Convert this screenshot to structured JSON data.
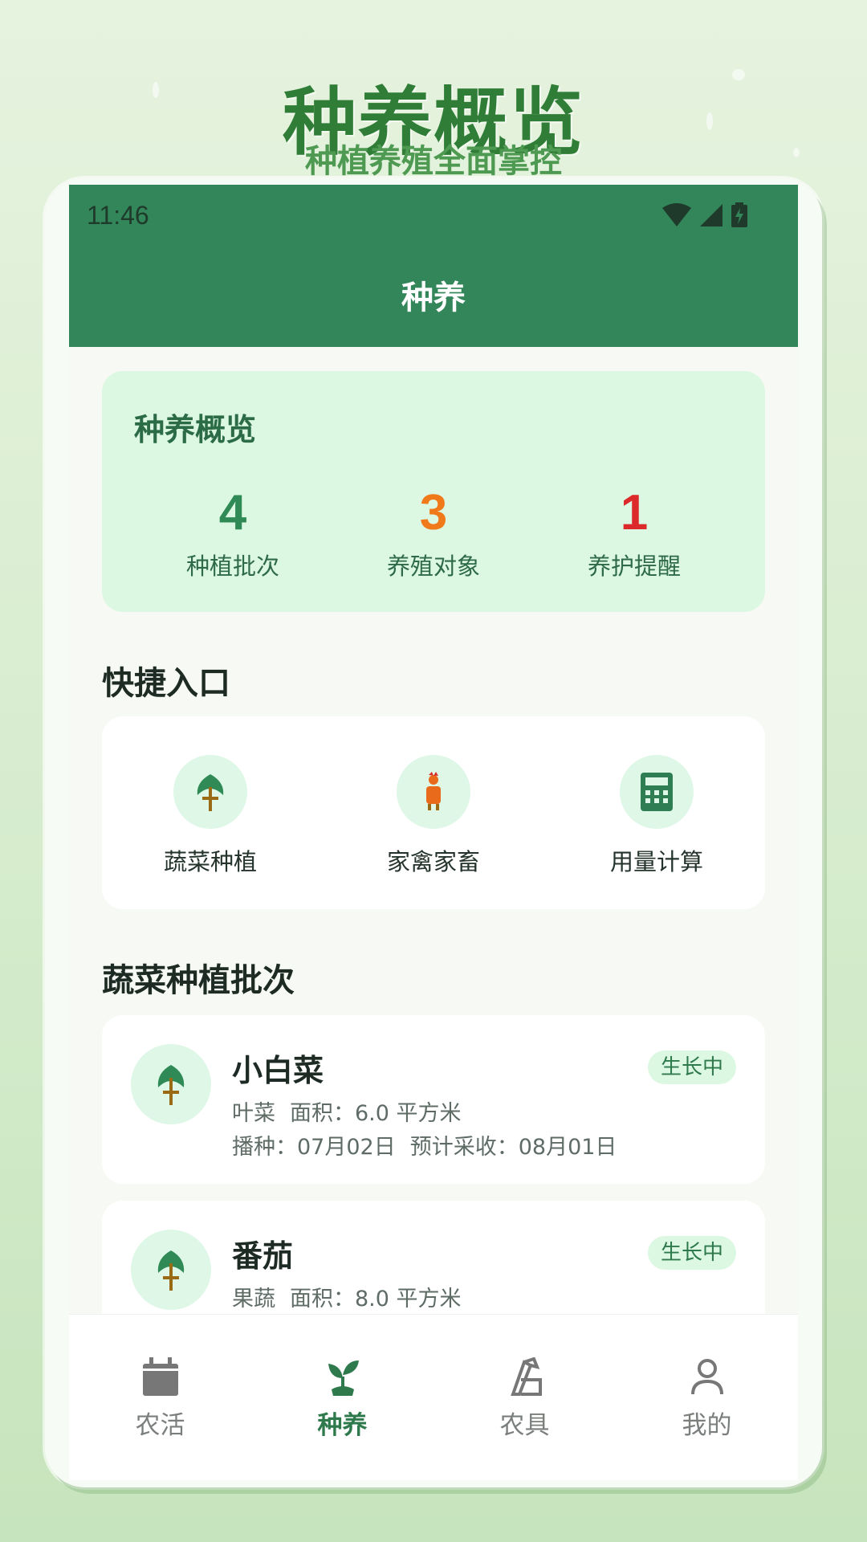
{
  "promo": {
    "title": "种养概览",
    "subtitle": "种植养殖全面掌控"
  },
  "status_bar": {
    "time": "11:46"
  },
  "app_bar": {
    "title": "种养"
  },
  "overview": {
    "title": "种养概览",
    "stats": [
      {
        "value": "4",
        "label": "种植批次",
        "color": "#2f8a56"
      },
      {
        "value": "3",
        "label": "养殖对象",
        "color": "#f07a1a"
      },
      {
        "value": "1",
        "label": "养护提醒",
        "color": "#dc2a2a"
      }
    ]
  },
  "quick_entry": {
    "title": "快捷入口",
    "items": [
      {
        "label": "蔬菜种植",
        "icon": "sprout-icon"
      },
      {
        "label": "家禽家畜",
        "icon": "poultry-icon"
      },
      {
        "label": "用量计算",
        "icon": "calculator-icon"
      }
    ]
  },
  "batches": {
    "title": "蔬菜种植批次",
    "items": [
      {
        "name": "小白菜",
        "status": "生长中",
        "type": "叶菜",
        "area": "面积：6.0 平方米",
        "sow": "播种：07月02日",
        "harvest": "预计采收：08月01日"
      },
      {
        "name": "番茄",
        "status": "生长中",
        "type": "果蔬",
        "area": "面积：8.0 平方米",
        "sow": "",
        "harvest": ""
      }
    ]
  },
  "bottom_nav": {
    "items": [
      {
        "label": "农活",
        "icon": "calendar-icon",
        "active": false
      },
      {
        "label": "种养",
        "icon": "plant-icon",
        "active": true
      },
      {
        "label": "农具",
        "icon": "tool-icon",
        "active": false
      },
      {
        "label": "我的",
        "icon": "user-icon",
        "active": false
      }
    ]
  },
  "colors": {
    "primary": "#32865a",
    "accent_green": "#2f8a56",
    "accent_orange": "#f07a1a",
    "accent_red": "#dc2a2a",
    "soft_green": "#dcf8e2"
  }
}
